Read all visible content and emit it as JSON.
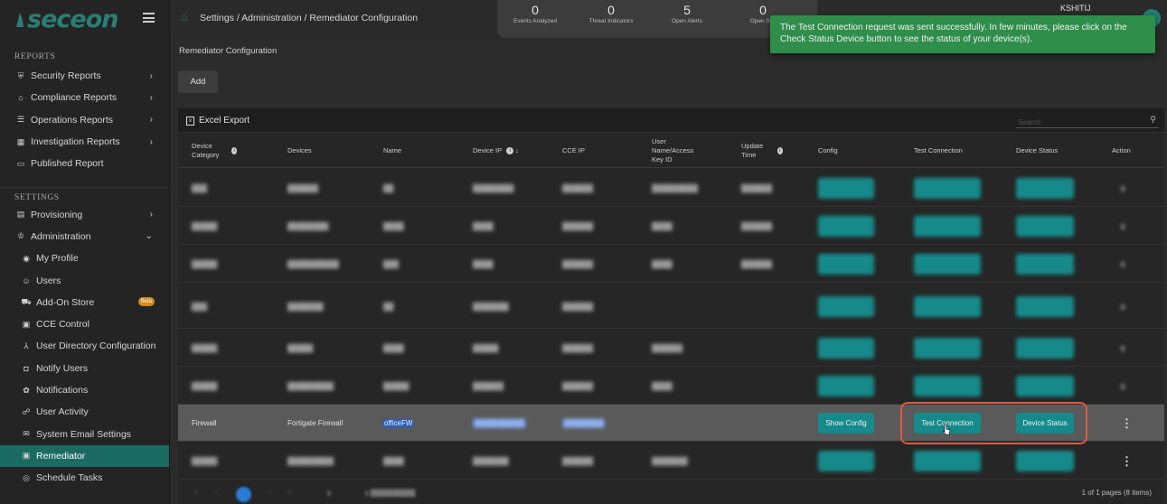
{
  "app": {
    "logo_text": "seceon"
  },
  "sidebar": {
    "reports_header": "REPORTS",
    "reports": [
      {
        "label": "Security Reports",
        "icon": "shield-icon"
      },
      {
        "label": "Compliance Reports",
        "icon": "bank-icon"
      },
      {
        "label": "Operations Reports",
        "icon": "server-icon"
      },
      {
        "label": "Investigation Reports",
        "icon": "report-icon"
      },
      {
        "label": "Published Report",
        "icon": "monitor-icon"
      }
    ],
    "settings_header": "SETTINGS",
    "settings": [
      {
        "label": "Provisioning",
        "icon": "list-icon"
      },
      {
        "label": "Administration",
        "icon": "admin-icon"
      }
    ],
    "admin_items": [
      {
        "label": "My Profile",
        "icon": "profile-icon"
      },
      {
        "label": "Users",
        "icon": "users-icon"
      },
      {
        "label": "Add-On Store",
        "icon": "store-icon",
        "badge": "Beta"
      },
      {
        "label": "CCE Control",
        "icon": "control-icon"
      },
      {
        "label": "User Directory Configuration",
        "icon": "directory-icon"
      },
      {
        "label": "Notify Users",
        "icon": "notify-icon"
      },
      {
        "label": "Notifications",
        "icon": "bell-icon"
      },
      {
        "label": "User Activity",
        "icon": "activity-icon"
      },
      {
        "label": "System Email Settings",
        "icon": "email-icon"
      },
      {
        "label": "Remediator",
        "icon": "remediator-icon",
        "active": true
      },
      {
        "label": "Schedule Tasks",
        "icon": "schedule-icon"
      }
    ]
  },
  "header": {
    "breadcrumb": "Settings / Administration / Remediator Configuration",
    "stats": [
      {
        "value": "0",
        "label": "Events Analyzed"
      },
      {
        "value": "0",
        "label": "Threat Indicators"
      },
      {
        "value": "5",
        "label": "Open Alerts"
      },
      {
        "value": "0",
        "label": "Open Sys"
      }
    ],
    "user_name": "KSHITIJ"
  },
  "toast": {
    "message": "The Test Connection request was sent successfully. In few minutes, please click on the Check Status Device button to see the status of your device(s)."
  },
  "main": {
    "page_title": "Remediator Configuration",
    "add_button": "Add",
    "excel_export": "Excel Export",
    "search_placeholder": "Search",
    "columns": {
      "device_category": "Device Category",
      "devices": "Devices",
      "name": "Name",
      "device_ip": "Device IP",
      "cce_ip": "CCE IP",
      "user_name": "User Name/Access Key ID",
      "update_time": "Update Time",
      "config": "Config",
      "test_connection": "Test Connection",
      "device_status": "Device Status",
      "action": "Action"
    },
    "visible_row": {
      "category": "Firewall",
      "device": "Fortigate Firewall",
      "name": "officeFW",
      "show_config": "Show Config",
      "test_connection": "Test Connection",
      "device_status": "Device Status"
    },
    "pagination_info": "1 of 1 pages (8 items)"
  },
  "colors": {
    "accent": "#168a8a",
    "active_nav": "#1b6b63",
    "toast": "#2f8e4a",
    "highlight": "#e05a3f"
  }
}
